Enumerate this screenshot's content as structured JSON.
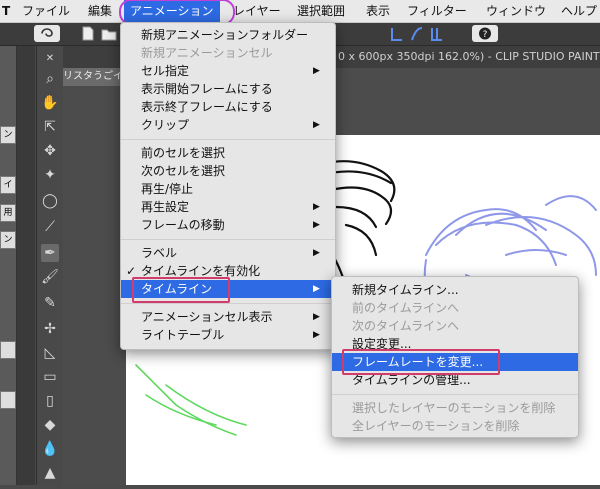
{
  "colors": {
    "accent": "#2d6ae3",
    "annotation_ring": "#c040d8",
    "annotation_box": "#d23c6a",
    "stroke_blue": "#8f98e8",
    "stroke_green": "#5ed85e"
  },
  "menubar": {
    "items": [
      "T",
      "ファイル",
      "編集",
      "アニメーション",
      "レイヤー",
      "選択範囲",
      "表示",
      "フィルター",
      "ウィンドウ",
      "ヘルプ"
    ]
  },
  "document": {
    "title": "0 x 600px 350dpi 162.0%) - CLIP STUDIO PAINT",
    "tab_label": "リスタうごイ"
  },
  "left_panel_tabs": [
    "ン",
    "イ",
    "用",
    "ン"
  ],
  "tools": [
    "zoom-icon",
    "hand-icon",
    "operation-icon",
    "move-icon",
    "selection-icon",
    "eyedropper-icon",
    "pen-icon",
    "brush-icon",
    "eraser-icon",
    "figure-icon",
    "ruler-icon",
    "text-icon",
    "fill-icon",
    "gradient-icon",
    "blend-icon"
  ],
  "animation_menu": {
    "items": [
      {
        "label": "新規アニメーションフォルダー",
        "enabled": true,
        "submenu": false
      },
      {
        "label": "新規アニメーションセル",
        "enabled": false,
        "submenu": false
      },
      {
        "label": "セル指定",
        "enabled": true,
        "submenu": true
      },
      {
        "label": "表示開始フレームにする",
        "enabled": true,
        "submenu": false
      },
      {
        "label": "表示終了フレームにする",
        "enabled": true,
        "submenu": false
      },
      {
        "label": "クリップ",
        "enabled": true,
        "submenu": true
      },
      {
        "label": "前のセルを選択",
        "enabled": true,
        "submenu": false
      },
      {
        "label": "次のセルを選択",
        "enabled": true,
        "submenu": false
      },
      {
        "label": "再生/停止",
        "enabled": true,
        "submenu": false
      },
      {
        "label": "再生設定",
        "enabled": true,
        "submenu": true
      },
      {
        "label": "フレームの移動",
        "enabled": true,
        "submenu": true
      },
      {
        "label": "ラベル",
        "enabled": true,
        "submenu": true
      },
      {
        "label": "タイムラインを有効化",
        "enabled": true,
        "submenu": false,
        "checked": true
      },
      {
        "label": "タイムライン",
        "enabled": true,
        "submenu": true,
        "highlighted": true
      },
      {
        "label": "アニメーションセル表示",
        "enabled": true,
        "submenu": true
      },
      {
        "label": "ライトテーブル",
        "enabled": true,
        "submenu": true
      }
    ]
  },
  "timeline_submenu": {
    "items": [
      {
        "label": "新規タイムライン...",
        "enabled": true
      },
      {
        "label": "前のタイムラインへ",
        "enabled": false
      },
      {
        "label": "次のタイムラインへ",
        "enabled": false
      },
      {
        "label": "設定変更...",
        "enabled": true
      },
      {
        "label": "フレームレートを変更...",
        "enabled": true,
        "highlighted": true
      },
      {
        "label": "タイムラインの管理...",
        "enabled": true
      },
      {
        "label": "選択したレイヤーのモーションを削除",
        "enabled": false
      },
      {
        "label": "全レイヤーのモーションを削除",
        "enabled": false
      }
    ]
  }
}
